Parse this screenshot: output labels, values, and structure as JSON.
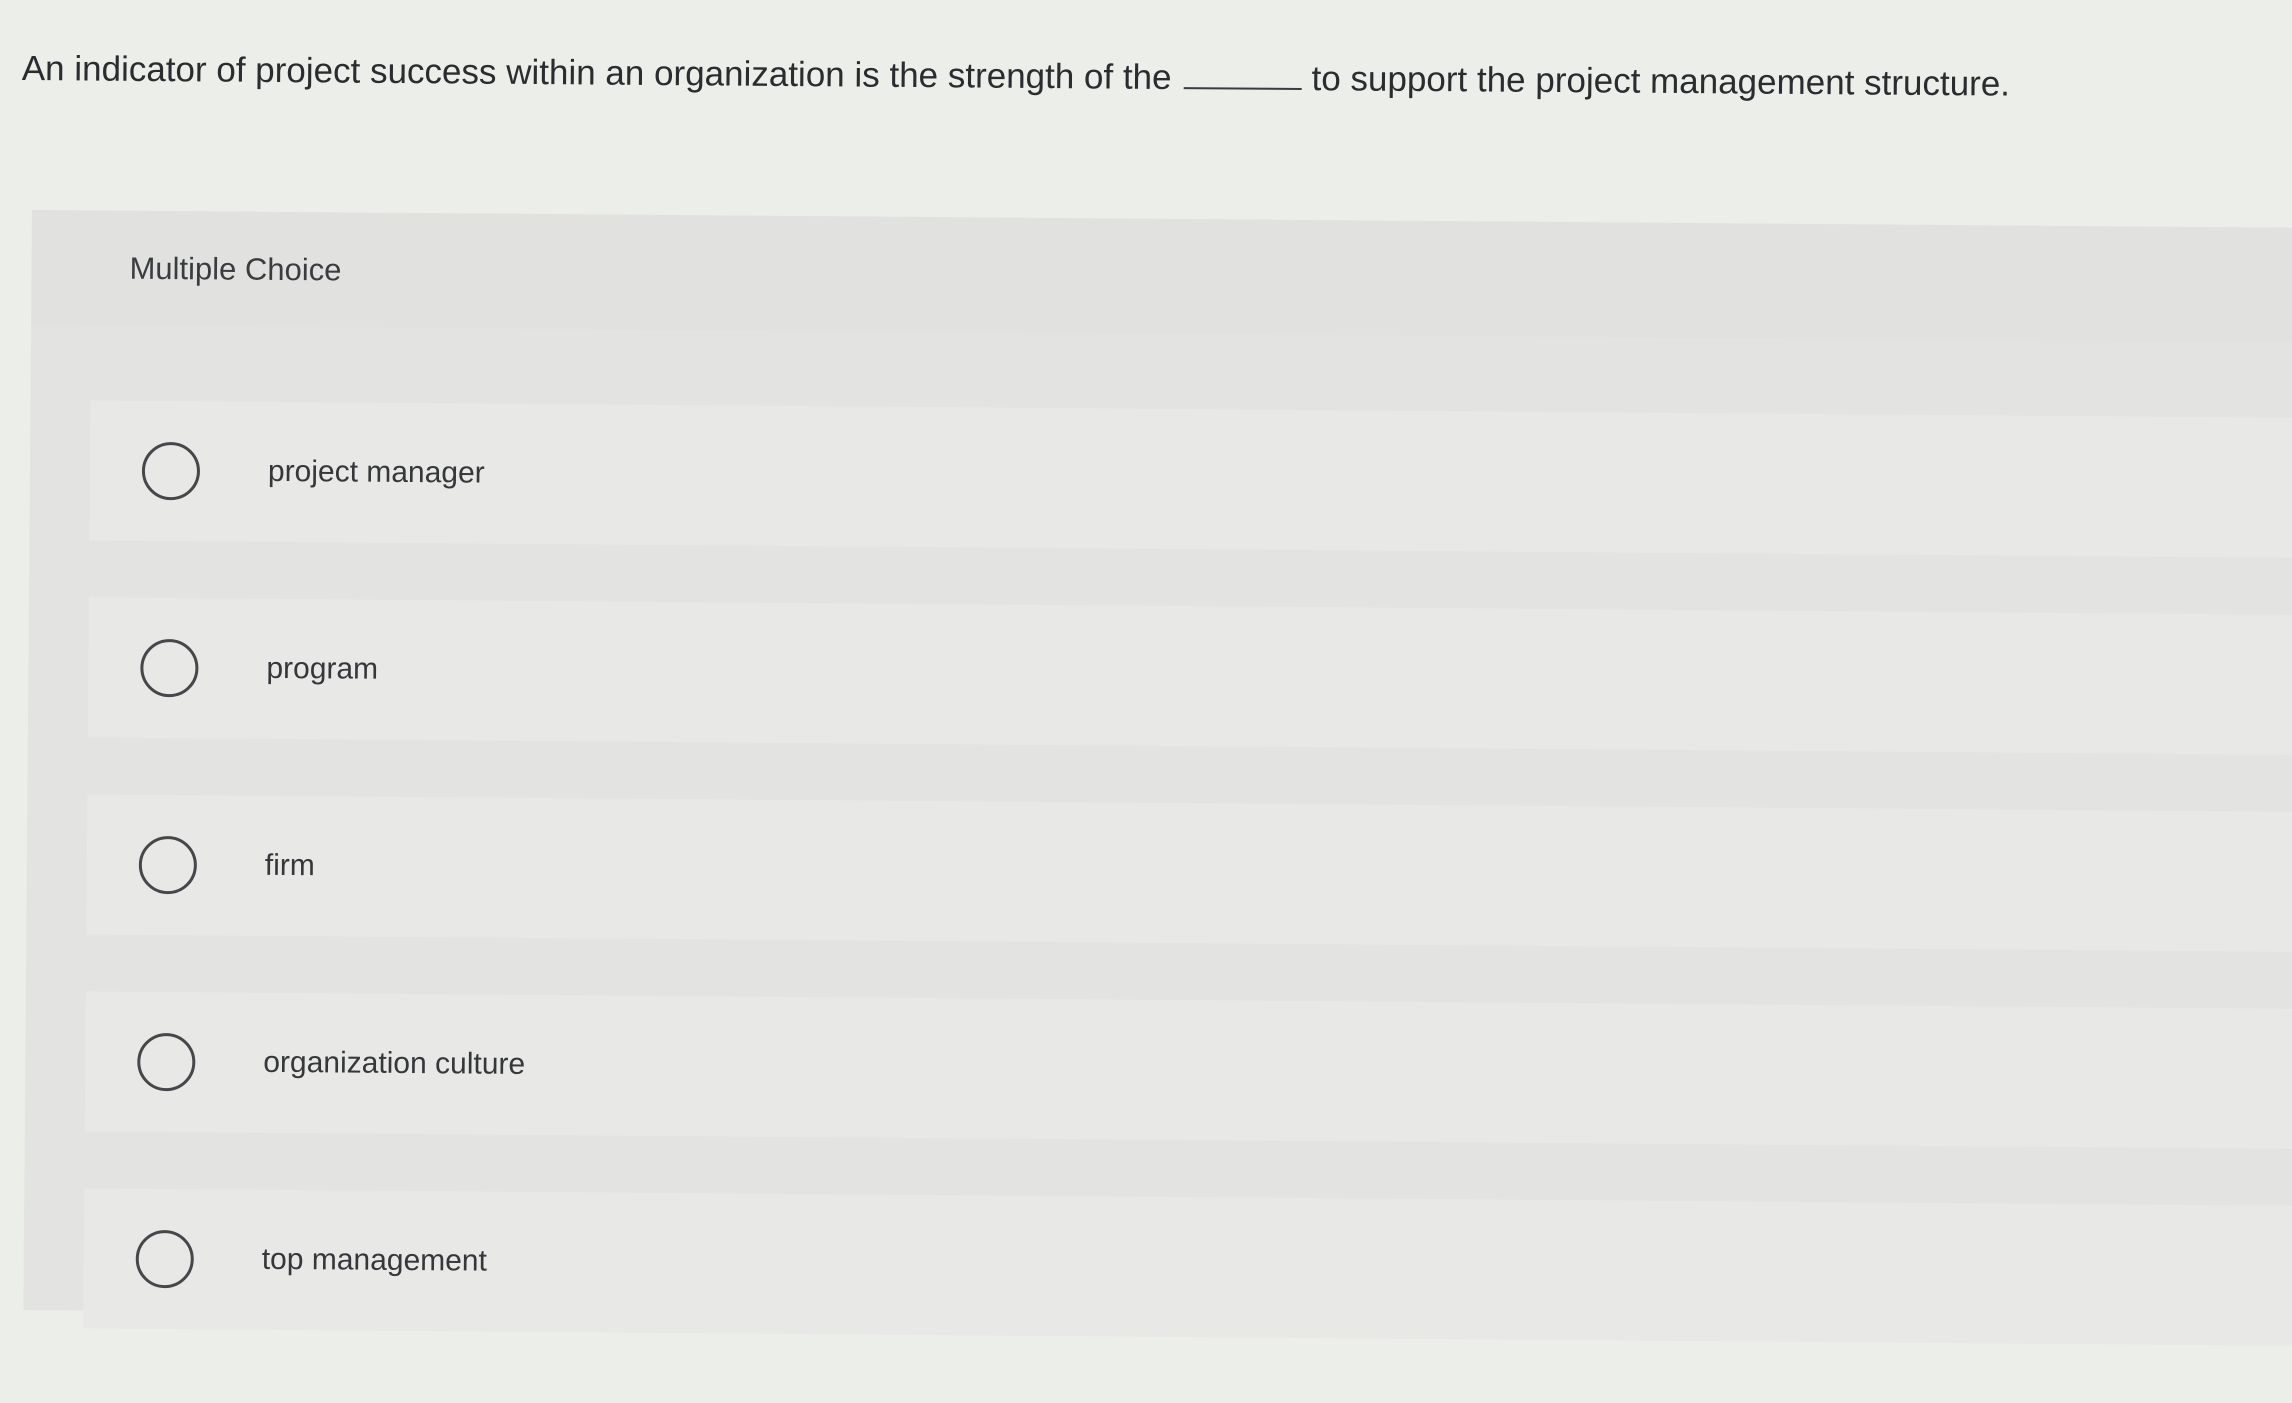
{
  "question": {
    "text_before": "An indicator of project success within an organization is the strength of the",
    "text_after": "to support the project management structure."
  },
  "card": {
    "label": "Multiple Choice"
  },
  "options": [
    {
      "label": "project manager"
    },
    {
      "label": "program"
    },
    {
      "label": "firm"
    },
    {
      "label": "organization culture"
    },
    {
      "label": "top management"
    }
  ]
}
